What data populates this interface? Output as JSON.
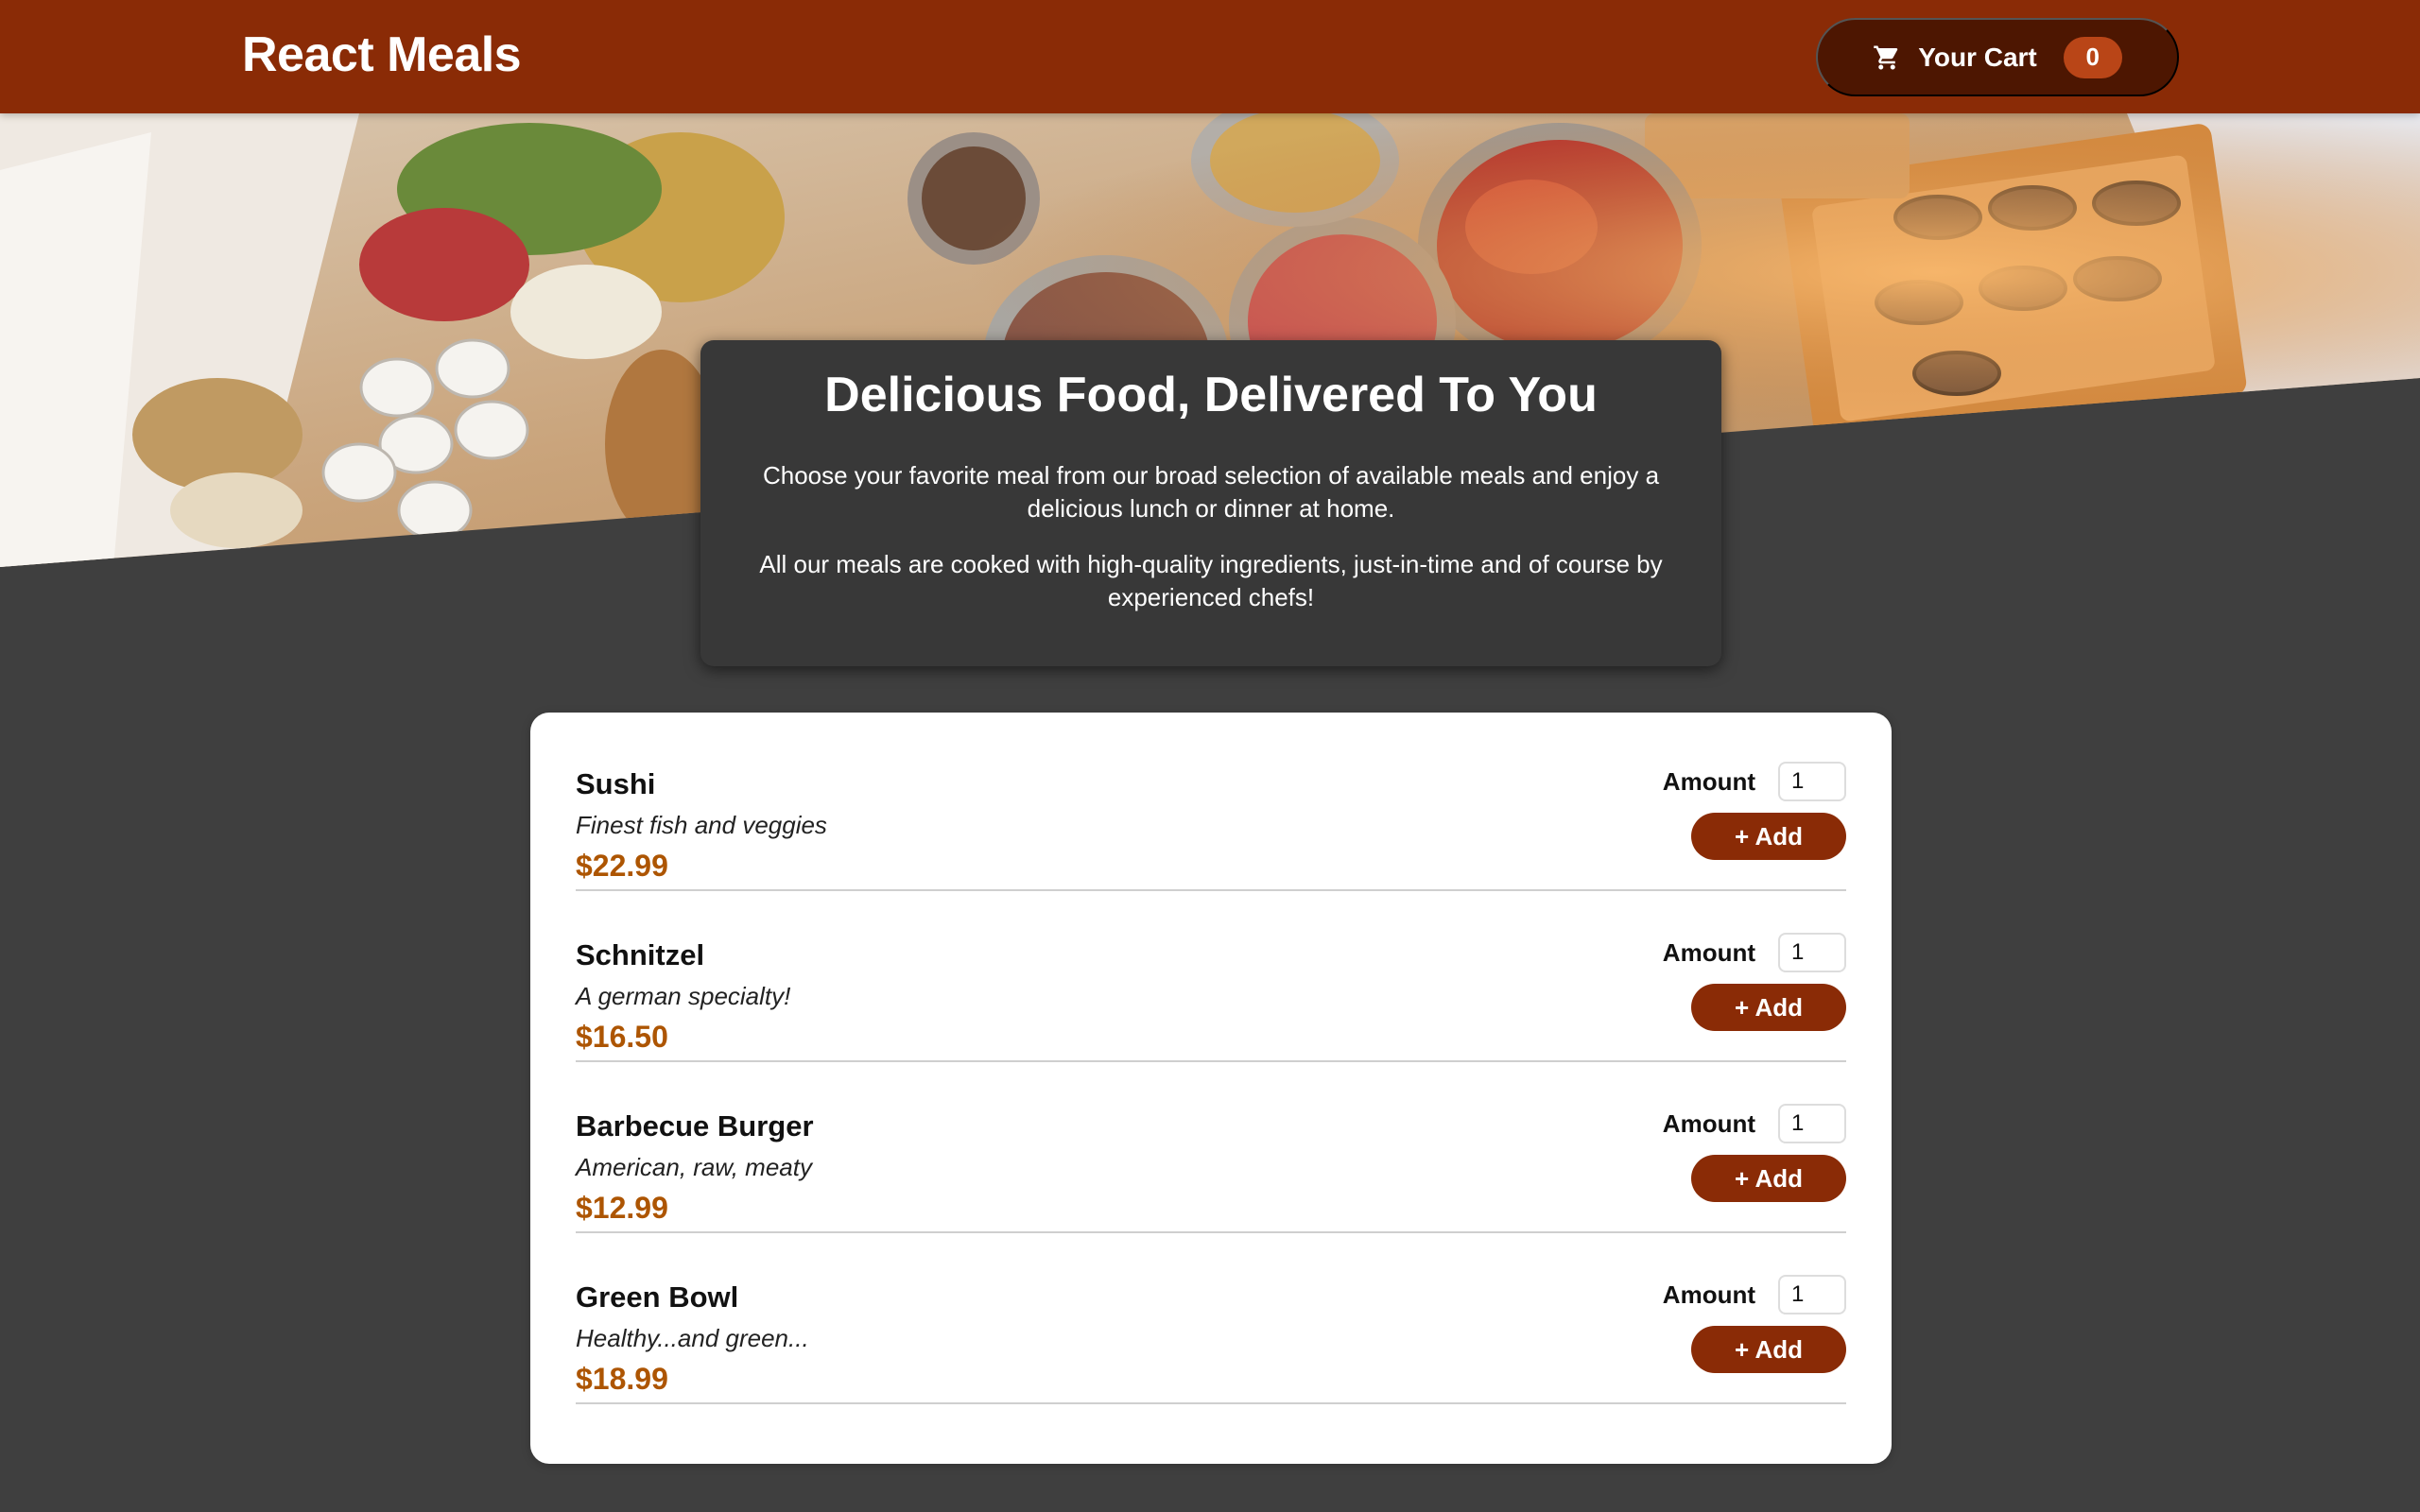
{
  "header": {
    "brand": "React Meals",
    "cart": {
      "icon": "cart-icon",
      "label": "Your Cart",
      "count": "0"
    }
  },
  "colors": {
    "header_bg": "#8a2b06",
    "cart_bg": "#4d1601",
    "badge_bg": "#b94517",
    "page_bg": "#3f3f3f",
    "price": "#ad5502",
    "button_bg": "#8a2b06"
  },
  "summary": {
    "title": "Delicious Food, Delivered To You",
    "paragraph1": "Choose your favorite meal from our broad selection of available meals and enjoy a delicious lunch or dinner at home.",
    "paragraph2": "All our meals are cooked with high-quality ingredients, just-in-time and of course by experienced chefs!"
  },
  "meals": [
    {
      "name": "Sushi",
      "description": "Finest fish and veggies",
      "price": "$22.99",
      "amount_label": "Amount",
      "amount_value": "1",
      "add_label": "+ Add"
    },
    {
      "name": "Schnitzel",
      "description": "A german specialty!",
      "price": "$16.50",
      "amount_label": "Amount",
      "amount_value": "1",
      "add_label": "+ Add"
    },
    {
      "name": "Barbecue Burger",
      "description": "American, raw, meaty",
      "price": "$12.99",
      "amount_label": "Amount",
      "amount_value": "1",
      "add_label": "+ Add"
    },
    {
      "name": "Green Bowl",
      "description": "Healthy...and green...",
      "price": "$18.99",
      "amount_label": "Amount",
      "amount_value": "1",
      "add_label": "+ Add"
    }
  ]
}
